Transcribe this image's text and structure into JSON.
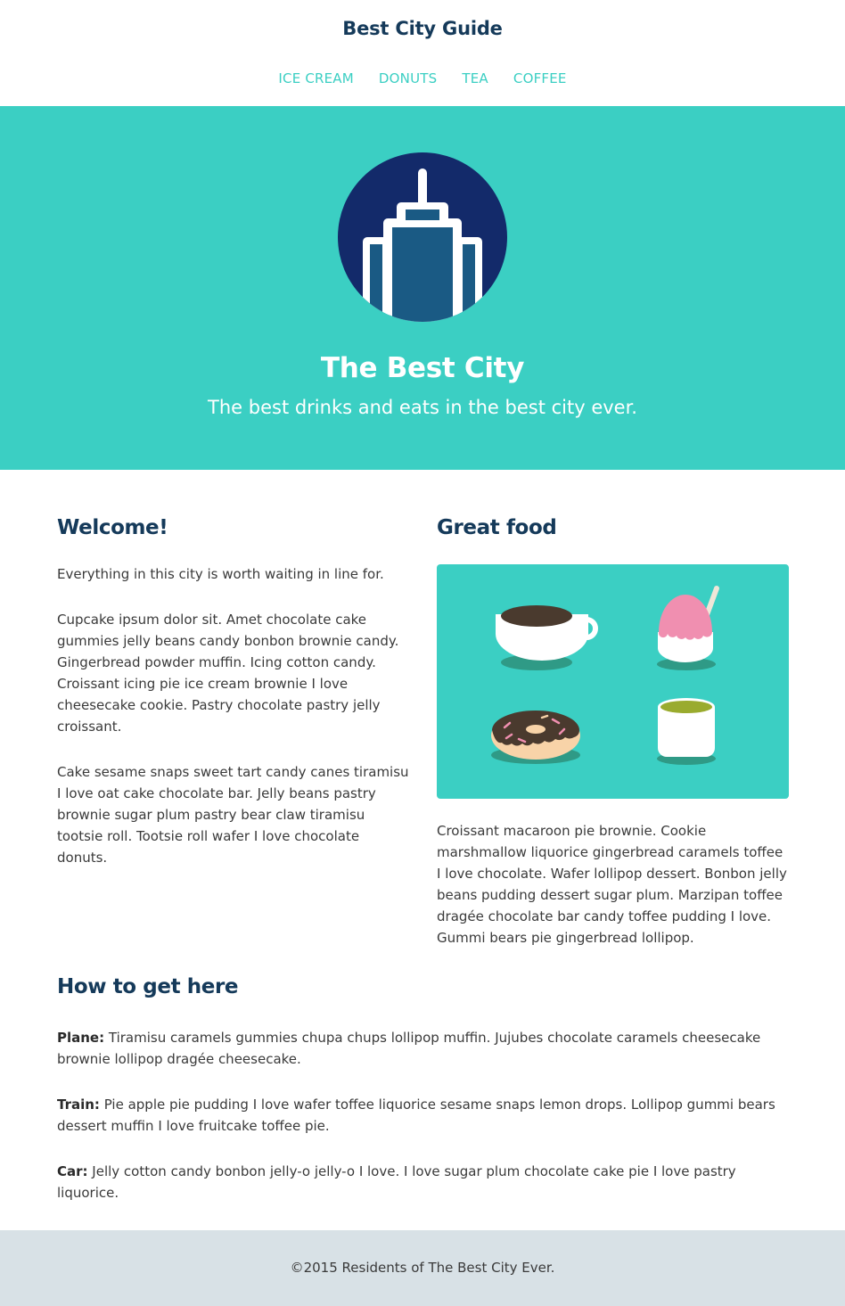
{
  "header": {
    "site_title": "Best City Guide",
    "nav": [
      "ICE CREAM",
      "DONUTS",
      "TEA",
      "COFFEE"
    ]
  },
  "hero": {
    "logo_icon": "skyscraper-icon",
    "title": "The Best City",
    "subtitle": "The best drinks and eats in the best city ever."
  },
  "welcome": {
    "heading": "Welcome!",
    "intro": "Everything in this city is worth waiting in line for.",
    "paragraphs": [
      "Cupcake ipsum dolor sit. Amet chocolate cake gummies jelly beans candy bonbon brownie candy. Gingerbread powder muffin. Icing cotton candy. Croissant icing pie ice cream brownie I love cheesecake cookie. Pastry chocolate pastry jelly croissant.",
      "Cake sesame snaps sweet tart candy canes tiramisu I love oat cake chocolate bar. Jelly beans pastry brownie sugar plum pastry bear claw tiramisu tootsie roll. Tootsie roll wafer I love chocolate donuts."
    ]
  },
  "food": {
    "heading": "Great food",
    "illustration_icons": [
      "coffee-cup-icon",
      "ice-cream-icon",
      "donut-icon",
      "tea-cup-icon"
    ],
    "text": "Croissant macaroon pie brownie. Cookie marshmallow liquorice gingerbread caramels toffee I love chocolate. Wafer lollipop dessert. Bonbon jelly beans pudding dessert sugar plum. Marzipan toffee dragée chocolate bar candy toffee pudding I love. Gummi bears pie gingerbread lollipop."
  },
  "directions": {
    "heading": "How to get here",
    "items": [
      {
        "label": "Plane:",
        "text": " Tiramisu caramels gummies chupa chups lollipop muffin. Jujubes chocolate caramels cheesecake brownie lollipop dragée cheesecake."
      },
      {
        "label": "Train:",
        "text": " Pie apple pie pudding I love wafer toffee liquorice sesame snaps lemon drops. Lollipop gummi bears dessert muffin I love fruitcake toffee pie."
      },
      {
        "label": "Car:",
        "text": " Jelly cotton candy bonbon jelly-o jelly-o I love. I love sugar plum chocolate cake pie I love pastry liquorice."
      }
    ]
  },
  "footer": {
    "text": "©2015 Residents of The Best City Ever."
  },
  "colors": {
    "accent": "#3bcfc3",
    "heading": "#153a5a",
    "footer_bg": "#d8e1e6",
    "logo_circle": "#132a6a"
  }
}
